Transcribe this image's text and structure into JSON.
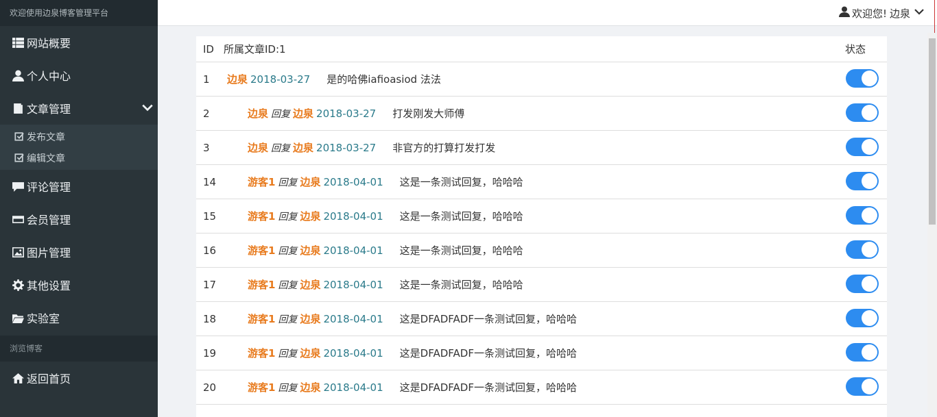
{
  "sidebar": {
    "title": "欢迎使用边泉博客管理平台",
    "items": [
      {
        "label": "网站概要",
        "icon": "list-icon"
      },
      {
        "label": "个人中心",
        "icon": "user-icon"
      },
      {
        "label": "文章管理",
        "icon": "book-icon",
        "expanded": true
      }
    ],
    "sub_items": [
      {
        "label": "发布文章",
        "icon": "edit-icon"
      },
      {
        "label": "编辑文章",
        "icon": "edit-icon"
      }
    ],
    "items2": [
      {
        "label": "评论管理",
        "icon": "comment-icon"
      },
      {
        "label": "会员管理",
        "icon": "card-icon"
      },
      {
        "label": "图片管理",
        "icon": "picture-icon"
      },
      {
        "label": "其他设置",
        "icon": "gear-icon"
      },
      {
        "label": "实验室",
        "icon": "folder-icon"
      }
    ],
    "section": "浏览博客",
    "home": {
      "label": "返回首页",
      "icon": "home-icon"
    }
  },
  "topbar": {
    "greeting": "欢迎您!",
    "user": "边泉"
  },
  "table": {
    "col_id": "ID",
    "col_title": "所属文章ID:1",
    "col_status": "状态",
    "reply_word": "回复",
    "rows": [
      {
        "id": "1",
        "author": "边泉",
        "reply_to": "",
        "date": "2018-03-27",
        "content": "是的哈佛iafioasiod 法法",
        "enabled": true
      },
      {
        "id": "2",
        "author": "边泉",
        "reply_to": "边泉",
        "date": "2018-03-27",
        "content": "打发刚发大师傅",
        "enabled": true
      },
      {
        "id": "3",
        "author": "边泉",
        "reply_to": "边泉",
        "date": "2018-03-27",
        "content": "非官方的打算打发打发",
        "enabled": true
      },
      {
        "id": "14",
        "author": "游客1",
        "reply_to": "边泉",
        "date": "2018-04-01",
        "content": "这是一条测试回复，哈哈哈",
        "enabled": true
      },
      {
        "id": "15",
        "author": "游客1",
        "reply_to": "边泉",
        "date": "2018-04-01",
        "content": "这是一条测试回复，哈哈哈",
        "enabled": true
      },
      {
        "id": "16",
        "author": "游客1",
        "reply_to": "边泉",
        "date": "2018-04-01",
        "content": "这是一条测试回复，哈哈哈",
        "enabled": true
      },
      {
        "id": "17",
        "author": "游客1",
        "reply_to": "边泉",
        "date": "2018-04-01",
        "content": "这是一条测试回复，哈哈哈",
        "enabled": true
      },
      {
        "id": "18",
        "author": "游客1",
        "reply_to": "边泉",
        "date": "2018-04-01",
        "content": "这是DFADFADF一条测试回复，哈哈哈",
        "enabled": true
      },
      {
        "id": "19",
        "author": "游客1",
        "reply_to": "边泉",
        "date": "2018-04-01",
        "content": "这是DFADFADF一条测试回复，哈哈哈",
        "enabled": true
      },
      {
        "id": "20",
        "author": "游客1",
        "reply_to": "边泉",
        "date": "2018-04-01",
        "content": "这是DFADFADF一条测试回复，哈哈哈",
        "enabled": true
      }
    ]
  },
  "colors": {
    "sidebar_bg": "#2a3439",
    "author": "#e87b1e",
    "date": "#2a7a8a",
    "toggle_on": "#2d8cf0"
  }
}
